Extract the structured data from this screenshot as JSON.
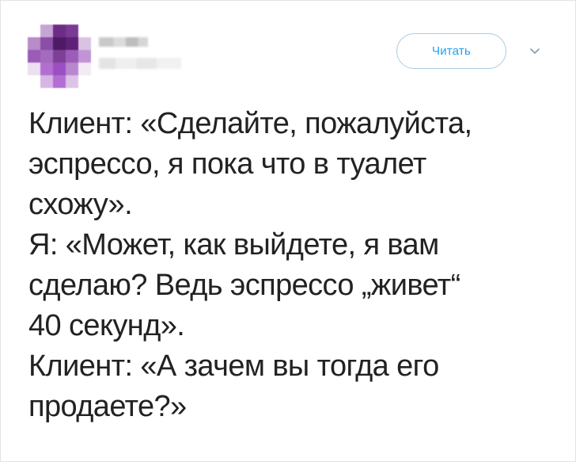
{
  "header": {
    "follow_label": "Читать",
    "avatar_icon": "avatar-icon",
    "menu_icon": "chevron-down-icon"
  },
  "tweet": {
    "lines": [
      "Клиент: «Сделайте, пожалуйста,",
      "эспрессо, я пока что в туалет",
      "схожу».",
      "Я: «Может, как выйдете, я вам",
      "сделаю? Ведь эспрессо „живет“",
      "40 секунд».",
      "Клиент: «А зачем вы тогда его",
      "продаете?»"
    ]
  },
  "colors": {
    "accent": "#1da1f2",
    "text": "#222222",
    "border": "#dfe3e6"
  }
}
